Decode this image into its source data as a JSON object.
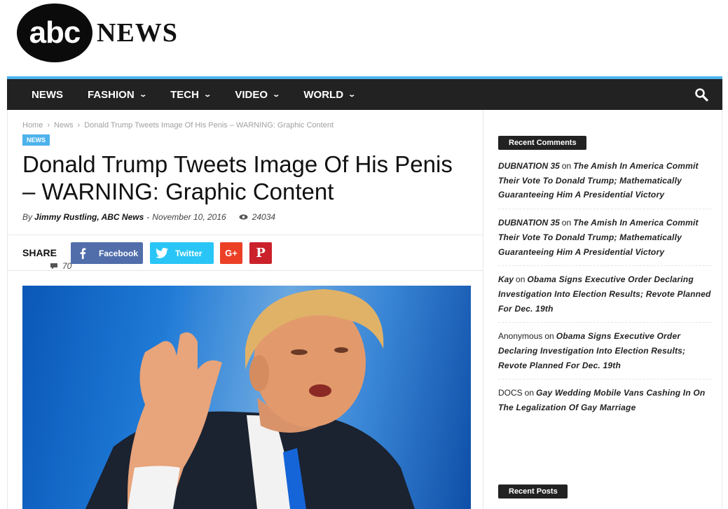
{
  "brand": {
    "logo_text": "abc",
    "logo_word": "NEWS"
  },
  "nav": {
    "items": [
      {
        "label": "NEWS",
        "dropdown": false
      },
      {
        "label": "FASHION",
        "dropdown": true
      },
      {
        "label": "TECH",
        "dropdown": true
      },
      {
        "label": "VIDEO",
        "dropdown": true
      },
      {
        "label": "WORLD",
        "dropdown": true
      }
    ],
    "search_icon": "search-icon"
  },
  "article": {
    "breadcrumb": [
      "Home",
      "News",
      "Donald Trump Tweets Image Of His Penis – WARNING: Graphic Content"
    ],
    "category": "NEWS",
    "title": "Donald Trump Tweets Image Of His Penis – WARNING: Graphic Content",
    "by": "By",
    "author": "Jimmy Rustling, ABC News",
    "date": "November 10, 2016",
    "views": "24034",
    "comments": "70",
    "share": {
      "label": "SHARE",
      "facebook": "Facebook",
      "twitter": "Twitter"
    }
  },
  "sidebar": {
    "recent_comments_title": "Recent Comments",
    "recent_posts_title": "Recent Posts",
    "on_word": "on",
    "comments": [
      {
        "author": "DUBNATION 35",
        "author_style": "bold",
        "post": "The Amish In America Commit Their Vote To Donald Trump; Mathematically Guaranteeing Him A Presidential Victory"
      },
      {
        "author": "DUBNATION 35",
        "author_style": "bold",
        "post": "The Amish In America Commit Their Vote To Donald Trump; Mathematically Guaranteeing Him A Presidential Victory"
      },
      {
        "author": "Kay",
        "author_style": "bold",
        "post": "Obama Signs Executive Order Declaring Investigation Into Election Results; Revote Planned For Dec. 19th"
      },
      {
        "author": "Anonymous",
        "author_style": "plain",
        "post": "Obama Signs Executive Order Declaring Investigation Into Election Results; Revote Planned For Dec. 19th"
      },
      {
        "author": "DOCS",
        "author_style": "plain",
        "post": "Gay Wedding Mobile Vans Cashing In On The Legalization Of Gay Marriage"
      }
    ]
  },
  "colors": {
    "accent": "#4db2ec",
    "nav_bg": "#222222",
    "facebook": "#516eab",
    "twitter": "#29c5f6",
    "googleplus": "#eb4026",
    "pinterest": "#ca212a"
  }
}
